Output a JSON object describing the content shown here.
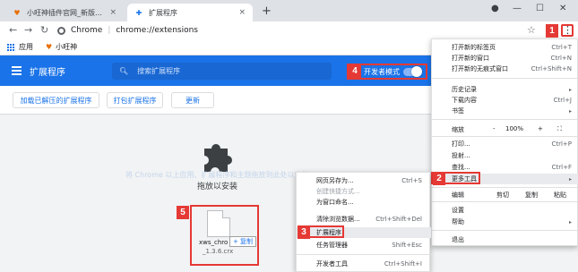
{
  "tabs": [
    {
      "title": "小旺神插件官网_新版全登参谋拓..."
    },
    {
      "title": "扩展程序"
    }
  ],
  "address": {
    "site_label": "Chrome",
    "url": "chrome://extensions"
  },
  "bookmarks": [
    {
      "label": "应用"
    },
    {
      "label": "小旺神"
    }
  ],
  "extensions": {
    "title": "扩展程序",
    "search_placeholder": "搜索扩展程序",
    "dev_mode_label": "开发者模式",
    "dev_mode_on": true,
    "buttons": [
      "加载已解压的扩展程序",
      "打包扩展程序",
      "更新"
    ],
    "drop_hint": "拖放以安装",
    "faint_hint": "将 Chrome 以上应用、扩展程序和主题拖放到此处以安装",
    "file_name": "xws_chro",
    "file_name2": "_1.3.6.crx",
    "copy_tip": "+ 复制"
  },
  "menu": {
    "items": [
      {
        "label": "打开新的标签页",
        "shortcut": "Ctrl+T"
      },
      {
        "label": "打开新的窗口",
        "shortcut": "Ctrl+N"
      },
      {
        "label": "打开新的无痕式窗口",
        "shortcut": "Ctrl+Shift+N"
      },
      {
        "label": "历史记录",
        "shortcut": "▸"
      },
      {
        "label": "下载内容",
        "shortcut": "Ctrl+J"
      },
      {
        "label": "书签",
        "shortcut": "▸"
      },
      {
        "label": "打印...",
        "shortcut": "Ctrl+P"
      },
      {
        "label": "投射..."
      },
      {
        "label": "查找...",
        "shortcut": "Ctrl+F"
      },
      {
        "label": "更多工具",
        "shortcut": "▸"
      },
      {
        "label": "设置"
      },
      {
        "label": "帮助",
        "shortcut": "▸"
      },
      {
        "label": "退出"
      }
    ],
    "zoom": {
      "label": "缩放",
      "minus": "-",
      "value": "100%",
      "plus": "+",
      "fullscreen": "⛶"
    },
    "edit": {
      "label": "编辑",
      "cut": "剪切",
      "copy": "复制",
      "paste": "粘贴"
    }
  },
  "submenu": {
    "items": [
      {
        "label": "网页另存为...",
        "shortcut": "Ctrl+S"
      },
      {
        "label": "创建快捷方式..."
      },
      {
        "label": "为窗口命名..."
      },
      {
        "label": "清除浏览数据...",
        "shortcut": "Ctrl+Shift+Del"
      },
      {
        "label": "扩展程序"
      },
      {
        "label": "任务管理器",
        "shortcut": "Shift+Esc"
      },
      {
        "label": "开发者工具",
        "shortcut": "Ctrl+Shift+I"
      }
    ]
  },
  "steps": [
    "1",
    "2",
    "3",
    "4",
    "5"
  ],
  "colors": {
    "accent": "#1a73e8",
    "highlight": "#e53935"
  }
}
